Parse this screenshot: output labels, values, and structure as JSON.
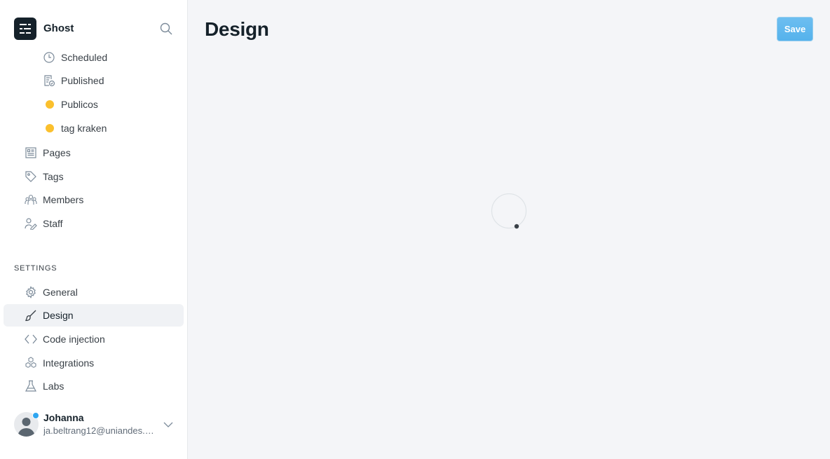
{
  "brand": {
    "name": "Ghost"
  },
  "nav": {
    "post_filters": [
      {
        "label": "Scheduled",
        "icon": "clock-icon"
      },
      {
        "label": "Published",
        "icon": "published-icon"
      },
      {
        "label": "Publicos",
        "icon": "tag-dot",
        "color": "#fbc02d"
      },
      {
        "label": "tag kraken",
        "icon": "tag-dot",
        "color": "#fbc02d"
      }
    ],
    "main": [
      {
        "label": "Pages",
        "icon": "pages-icon"
      },
      {
        "label": "Tags",
        "icon": "tag-icon"
      },
      {
        "label": "Members",
        "icon": "members-icon"
      },
      {
        "label": "Staff",
        "icon": "staff-icon"
      }
    ],
    "settings_title": "SETTINGS",
    "settings": [
      {
        "label": "General",
        "icon": "gear-icon"
      },
      {
        "label": "Design",
        "icon": "brush-icon",
        "active": true
      },
      {
        "label": "Code injection",
        "icon": "code-icon"
      },
      {
        "label": "Integrations",
        "icon": "integrations-icon"
      },
      {
        "label": "Labs",
        "icon": "flask-icon"
      }
    ]
  },
  "user": {
    "name": "Johanna",
    "email": "ja.beltrang12@uniandes.e..."
  },
  "main": {
    "title": "Design",
    "save_label": "Save"
  },
  "colors": {
    "accent": "#55b2ec",
    "tag_dot": "#fbc02d",
    "online": "#30a6f0"
  }
}
